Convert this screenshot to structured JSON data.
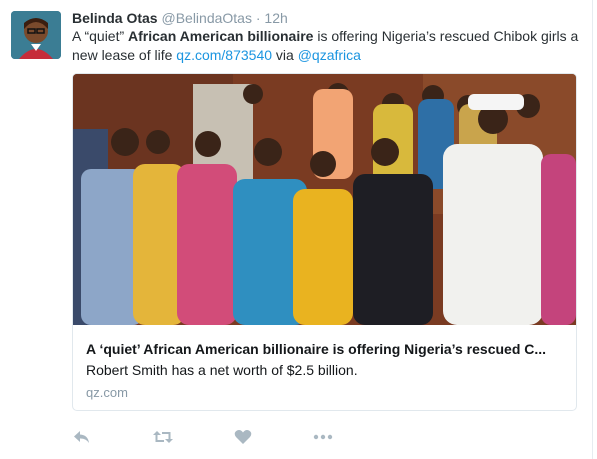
{
  "tweet": {
    "author_name": "Belinda Otas",
    "author_handle": "@BelindaOtas",
    "separator": "·",
    "timestamp": "12h",
    "text_1": "A “quiet” ",
    "text_bold": "African American billionaire",
    "text_2": " is offering Nigeria’s rescued Chibok girls a new lease of life ",
    "link_url": "qz.com/873540",
    "text_via": " via ",
    "mention": "@qzafrica"
  },
  "card": {
    "title": "A ‘quiet’ African American billionaire is offering Nigeria’s rescued C...",
    "description": "Robert Smith has a net worth of $2.5 billion.",
    "domain": "qz.com",
    "photo": "group-photo-rescued-girls"
  },
  "actions": {
    "reply_icon": "reply-icon",
    "retweet_icon": "retweet-icon",
    "like_icon": "heart-icon",
    "more_icon": "more-dots-icon"
  },
  "colors": {
    "link": "#1b95e0",
    "muted": "#8899a6",
    "border": "#e1e8ed"
  }
}
